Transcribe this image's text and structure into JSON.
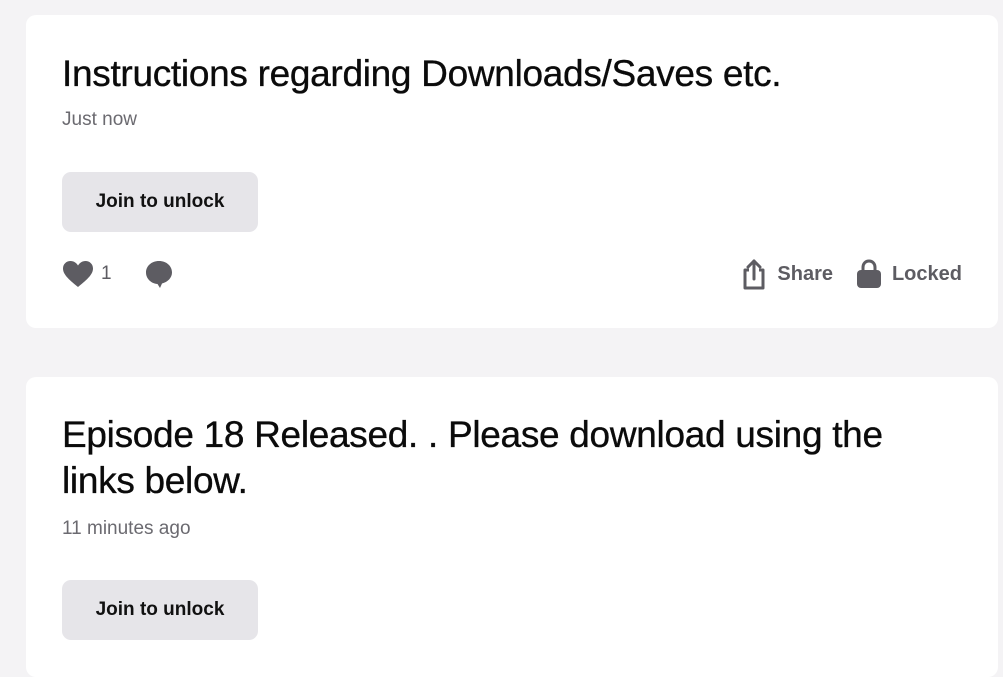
{
  "posts": [
    {
      "title": "Instructions regarding Downloads/Saves etc.",
      "time": "Just now",
      "join_label": "Join to unlock",
      "likes": "1",
      "share_label": "Share",
      "locked_label": "Locked"
    },
    {
      "title": "Episode 18 Released. . Please download using the links below.",
      "time": "11 minutes ago",
      "join_label": "Join to unlock"
    }
  ],
  "icons": {
    "like": "heart-icon",
    "comment": "comment-icon",
    "share": "share-icon",
    "locked": "lock-icon"
  },
  "colors": {
    "background": "#f4f3f5",
    "card": "#ffffff",
    "button": "#e6e5e9",
    "muted": "#5d5c62"
  }
}
